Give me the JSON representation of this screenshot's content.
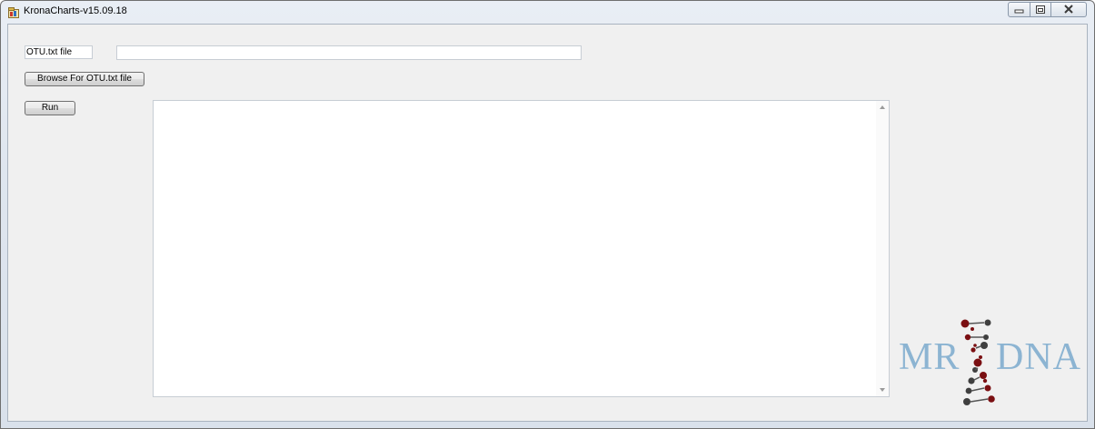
{
  "window": {
    "title": "KronaCharts-v15.09.18"
  },
  "form": {
    "file_label": "OTU.txt file",
    "path_value": "",
    "browse_label": "Browse For OTU.txt file",
    "run_label": "Run",
    "output_text": ""
  },
  "logo": {
    "left_text": "MR",
    "right_text": "DNA",
    "color": "#8cb4d2",
    "helix_color": "#7a0f12"
  },
  "icons": {
    "app": "app-icon",
    "minimize": "minimize-icon",
    "maximize": "maximize-icon",
    "close": "close-icon",
    "scroll_up": "scroll-up-arrow-icon",
    "scroll_down": "scroll-down-arrow-icon"
  }
}
